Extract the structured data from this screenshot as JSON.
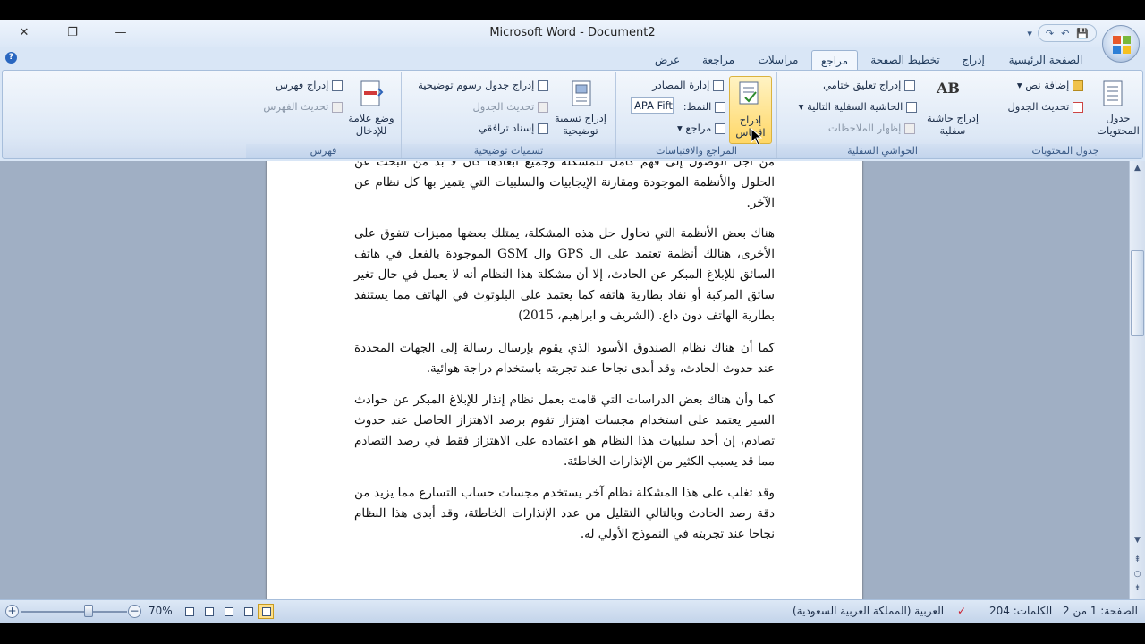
{
  "window": {
    "title": "Microsoft Word - Document2",
    "close_glyph": "✕",
    "restore_glyph": "❐",
    "minimize_glyph": "—"
  },
  "qat": {
    "save": "💾",
    "undo": "↶",
    "redo": "↷",
    "more": "▾"
  },
  "tabs": [
    {
      "label": "الصفحة الرئيسية"
    },
    {
      "label": "إدراج"
    },
    {
      "label": "تخطيط الصفحة"
    },
    {
      "label": "مراجع",
      "active": true
    },
    {
      "label": "مراسلات"
    },
    {
      "label": "مراجعة"
    },
    {
      "label": "عرض"
    }
  ],
  "ribbon": {
    "toc": {
      "label": "جدول المحتويات",
      "toc_button": "جدول المحتويات",
      "add_text": "إضافة نص",
      "update_table": "تحديث الجدول"
    },
    "footnotes": {
      "label": "الحواشي السفلية",
      "insert_footnote": "إدراج حاشية سفلية",
      "insert_endnote": "إدراج تعليق ختامي",
      "next_footnote": "الحاشية السفلية التالية",
      "show_notes": "إظهار الملاحظات",
      "ab_glyph": "AB"
    },
    "citations": {
      "label": "المراجع والاقتباسات",
      "insert_citation": "إدراج اقتباس",
      "manage_sources": "إدارة المصادر",
      "style_label": "النمط:",
      "style_value": "APA Fift",
      "bibliography": "مراجع"
    },
    "captions": {
      "label": "تسميات توضيحية",
      "insert_caption": "إدراج تسمية توضيحية",
      "insert_table_of_figures": "إدراج جدول رسوم توضيحية",
      "update_table": "تحديث الجدول",
      "cross_reference": "إسناد ترافقي"
    },
    "index": {
      "label": "فهرس",
      "mark_entry": "وضع علامة للإدخال",
      "insert_index": "إدراج فهرس",
      "update_index": "تحديث الفهرس"
    }
  },
  "document": {
    "paragraphs": [
      "من أجل الوصول إلى فهم كامل للمشكلة وجميع أبعادها كان لا بد من البحث عن الحلول والأنظمة الموجودة ومقارنة الإيجابيات والسلبيات التي يتميز بها كل نظام عن الآخر.",
      "هناك بعض الأنظمة التي تحاول حل هذه المشكلة، يمتلك بعضها مميزات تتفوق على الأخرى، هنالك أنظمة تعتمد على ال GPS وال GSM الموجودة بالفعل في هاتف السائق للإبلاغ المبكر عن الحادث، إلا أن مشكلة هذا النظام أنه لا يعمل في حال تغير سائق المركبة أو نفاذ بطارية هاتفه كما يعتمد على البلوتوث في الهاتف مما يستنفذ بطارية الهاتف دون داع. (الشريف و ابراهيم، 2015)",
      "كما أن هناك نظام الصندوق الأسود الذي يقوم بإرسال رسالة إلى الجهات المحددة عند حدوث الحادث، وقد أبدى نجاحا عند تجربته باستخدام دراجة هوائية.",
      "كما وأن هناك بعض الدراسات التي قامت بعمل نظام إنذار للإبلاغ المبكر عن حوادث السير يعتمد على استخدام مجسات اهتزاز تقوم برصد الاهتزاز الحاصل عند حدوث تصادم، إن أحد سلبيات هذا النظام هو اعتماده على الاهتزاز فقط في رصد التصادم مما قد يسبب الكثير من الإنذارات الخاطئة.",
      "وقد تغلب على هذا المشكلة نظام آخر يستخدم مجسات حساب التسارع مما يزيد من دقة رصد الحادث وبالتالي التقليل من عدد الإنذارات الخاطئة، وقد أبدى هذا النظام نجاحا عند تجربته في النموذج الأولي له."
    ]
  },
  "status": {
    "page": "الصفحة: 1 من 2",
    "words": "الكلمات: 204",
    "language": "العربية (المملكة العربية السعودية)",
    "zoom": "70%",
    "zoom_level": 70
  }
}
